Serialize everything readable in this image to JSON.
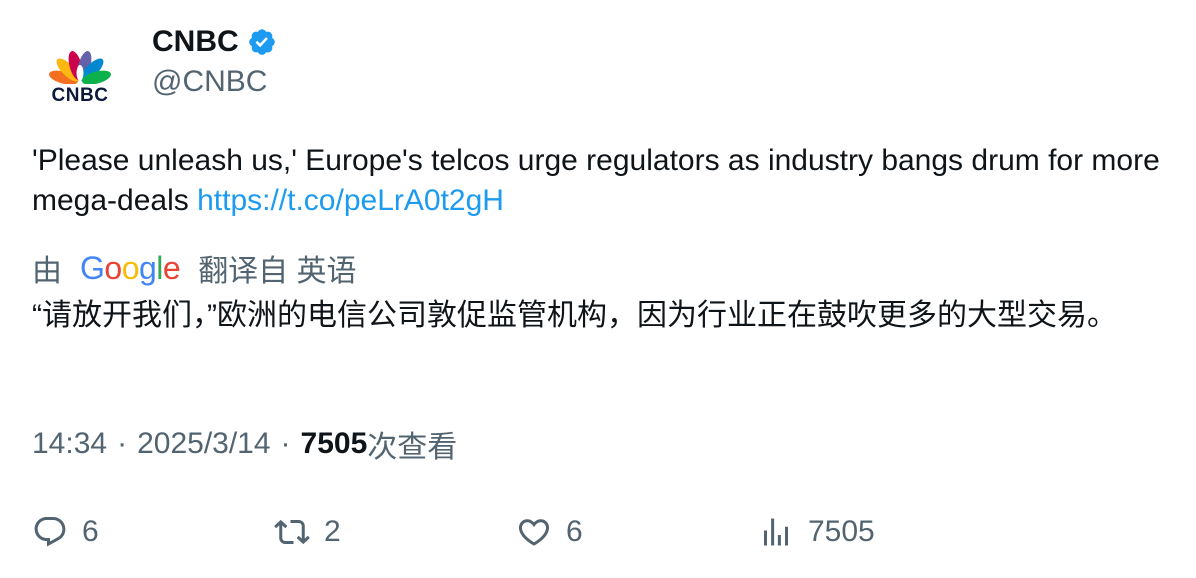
{
  "author": {
    "display_name": "CNBC",
    "handle": "@CNBC",
    "avatar_wordmark": "CNBC",
    "verified": true,
    "avatar_icon": "cnbc-peacock-logo"
  },
  "tweet": {
    "text": "'Please unleash us,' Europe's telcos urge regulators as industry bangs drum for more mega-deals ",
    "link": "https://t.co/peLrA0t2gH",
    "link_color": "#1d9bf0"
  },
  "translation": {
    "prefix": "由",
    "provider_letters": [
      "G",
      "o",
      "o",
      "g",
      "l",
      "e"
    ],
    "suffix": "翻译自 英语",
    "text": "“请放开我们，”欧洲的电信公司敦促监管机构，因为行业正在鼓吹更多的大型交易。"
  },
  "meta": {
    "time": "14:34",
    "separator": "·",
    "date": "2025/3/14",
    "views": "7505",
    "views_label": "次查看"
  },
  "actions": {
    "replies": "6",
    "reposts": "2",
    "likes": "6",
    "views": "7505"
  },
  "colors": {
    "text_primary": "#0f1419",
    "text_secondary": "#536471",
    "verified_badge": "#1d9bf0"
  }
}
